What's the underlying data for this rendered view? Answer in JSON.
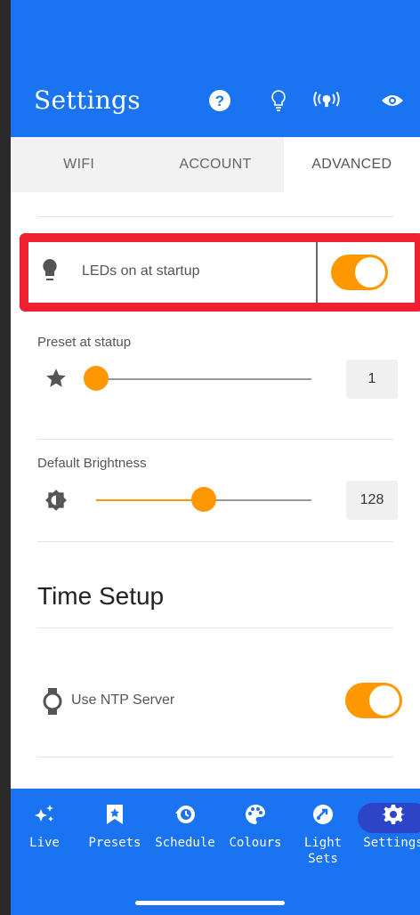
{
  "appbar": {
    "title": "Settings",
    "icons": [
      "help-icon",
      "bulb-icon",
      "broadcast-icon",
      "eye-icon"
    ]
  },
  "tabs": [
    {
      "label": "WIFI",
      "active": false
    },
    {
      "label": "ACCOUNT",
      "active": false
    },
    {
      "label": "ADVANCED",
      "active": true
    }
  ],
  "settings": {
    "leds_on_startup": {
      "label": "LEDs on at startup",
      "icon": "bulb-icon",
      "enabled": true
    },
    "preset_at_startup": {
      "label": "Preset at statup",
      "icon": "star-icon",
      "value": "1",
      "fraction": 0.0
    },
    "default_brightness": {
      "label": "Default Brightness",
      "icon": "brightness-icon",
      "value": "128",
      "fraction": 0.5
    },
    "time_setup": {
      "heading": "Time Setup"
    },
    "use_ntp": {
      "label": "Use NTP Server",
      "icon": "watch-icon",
      "enabled": true
    }
  },
  "colors": {
    "accent": "#ff9800",
    "primary": "#1a73f0",
    "highlight": "#ef2030"
  },
  "bottom_nav": [
    {
      "label": "Live",
      "icon": "sparkles-icon"
    },
    {
      "label": "Presets",
      "icon": "bookmark-star-icon"
    },
    {
      "label": "Schedule",
      "icon": "schedule-icon"
    },
    {
      "label": "Colours",
      "icon": "palette-icon"
    },
    {
      "label": "Light Sets",
      "icon": "light-sets-icon"
    },
    {
      "label": "Settings",
      "icon": "gear-icon",
      "active": true
    }
  ]
}
